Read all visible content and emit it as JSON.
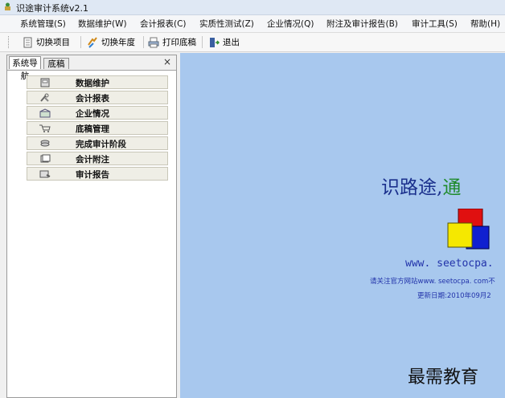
{
  "window": {
    "title": "识途审计系统v2.1"
  },
  "menu": [
    "系统管理(S)",
    "数据维护(W)",
    "会计报表(C)",
    "实质性测试(Z)",
    "企业情况(Q)",
    "附注及审计报告(B)",
    "审计工具(S)",
    "帮助(H)"
  ],
  "toolbar": {
    "switch_project": "切换项目",
    "switch_year": "切换年度",
    "print_draft": "打印底稿",
    "exit": "退出"
  },
  "left_panel": {
    "tabs": [
      "系统导航",
      "底稿"
    ],
    "close_glyph": "×",
    "nav_items": [
      {
        "label": "数据维护",
        "icon": "disk-icon"
      },
      {
        "label": "会计报表",
        "icon": "tools-icon"
      },
      {
        "label": "企业情况",
        "icon": "building-icon"
      },
      {
        "label": "底稿管理",
        "icon": "cart-icon"
      },
      {
        "label": "完成审计阶段",
        "icon": "stack-icon"
      },
      {
        "label": "会计附注",
        "icon": "pages-icon"
      },
      {
        "label": "审计报告",
        "icon": "report-icon"
      }
    ]
  },
  "main": {
    "slogan_main": "识路途,",
    "slogan_tail": "通",
    "url": "www. seetocpa.",
    "notice": "请关注官方网站www. seetocpa. com不",
    "update_date": "更新日期:2010年09月2",
    "watermark": "最需教育"
  },
  "colors": {
    "main_bg": "#a8c8ee",
    "slogan": "#1a2f8c",
    "slogan_accent": "#1e8a2a",
    "logo_red": "#e01010",
    "logo_yellow": "#f5e800",
    "logo_blue": "#1020d0"
  }
}
